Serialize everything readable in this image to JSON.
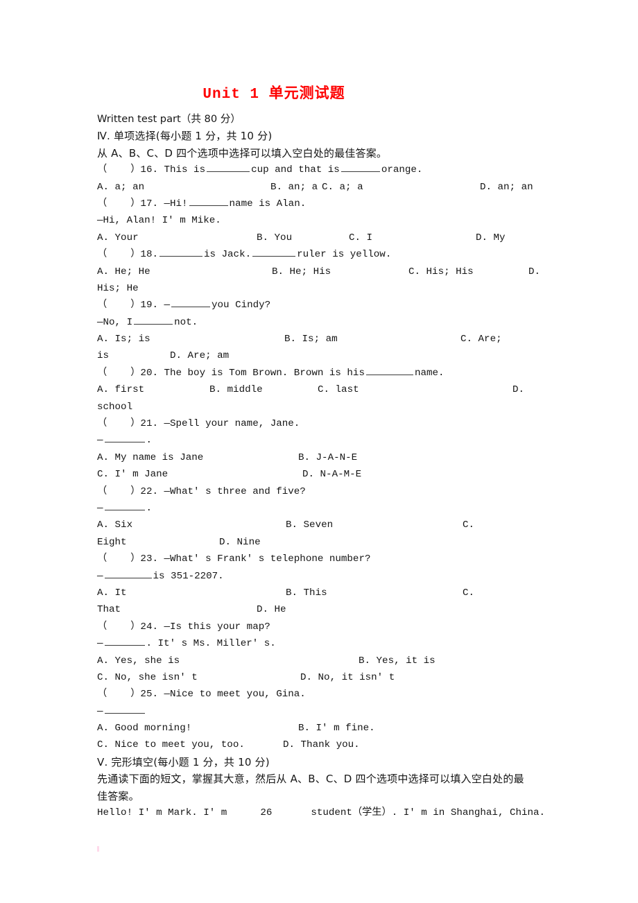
{
  "document": {
    "title": "Unit 1 单元测试题",
    "title_color": "#fe0000",
    "page_background": "#ffffff"
  },
  "intro": {
    "written_test_part": "Written test part（共 80 分）",
    "section_4_heading": "Ⅳ. 单项选择(每小题 1 分，共 10 分)",
    "section_4_instruction": "从 A、B、C、D 四个选项中选择可以填入空白处的最佳答案。"
  },
  "questions": [
    {
      "number": "16",
      "stem_prefix": "（    ）16. This is",
      "stem_middle": "cup and that is",
      "stem_suffix": "orange.",
      "options_line1": [
        "A. a; an",
        "B. an; a",
        "C. a; a",
        "D. an; an"
      ]
    },
    {
      "number": "17",
      "stem_prefix": "（    ）17. —Hi!",
      "stem_suffix": "name is Alan.",
      "stem_line2": "—Hi, Alan! I' m Mike.",
      "options_line1": [
        "A. Your",
        "B. You",
        "C. I",
        "D. My"
      ]
    },
    {
      "number": "18",
      "stem_prefix": "（    ）18.",
      "stem_middle": "is Jack.",
      "stem_suffix": "ruler is yellow.",
      "options_line1": [
        "A. He; He",
        "B. He; His",
        "C. His; His",
        "D."
      ],
      "options_line2": [
        "His; He"
      ]
    },
    {
      "number": "19",
      "stem_prefix": "（    ）19. —",
      "stem_suffix": "you Cindy?",
      "stem_line2_prefix": "—No, I",
      "stem_line2_suffix": "not.",
      "options_line1": [
        "A. Is; is",
        "B. Is; am",
        "C. Are;"
      ],
      "options_line2": [
        "is",
        "D. Are; am"
      ]
    },
    {
      "number": "20",
      "stem_prefix": "（    ）20. The boy is Tom Brown. Brown is his",
      "stem_suffix": "name.",
      "options_line1": [
        "A. first",
        "B. middle",
        "C. last",
        "D."
      ],
      "options_line2": [
        "school"
      ]
    },
    {
      "number": "21",
      "stem_prefix": "（    ）21. —Spell your name, Jane.",
      "stem_line2_prefix": "—",
      "stem_line2_suffix": ".",
      "options_line1": [
        "A. My name is Jane",
        "B. J-A-N-E"
      ],
      "options_line2": [
        "C. I' m Jane",
        "D. N-A-M-E"
      ]
    },
    {
      "number": "22",
      "stem_prefix": "（    ）22. —What' s three and five?",
      "stem_line2_prefix": "—",
      "stem_line2_suffix": ".",
      "options_line1": [
        "A. Six",
        "B. Seven",
        "C."
      ],
      "options_line2": [
        "Eight",
        "D. Nine"
      ]
    },
    {
      "number": "23",
      "stem_prefix": "（    ）23. —What' s Frank' s telephone number?",
      "stem_line2_prefix": "—",
      "stem_line2_suffix": "is 351-2207.",
      "options_line1": [
        "A. It",
        "B. This",
        "C."
      ],
      "options_line2": [
        "That",
        "D. He"
      ]
    },
    {
      "number": "24",
      "stem_prefix": "（    ）24. —Is this your map?",
      "stem_line2_prefix": "—",
      "stem_line2_suffix": ". It' s Ms. Miller' s.",
      "options_line1": [
        "A. Yes, she is",
        "B. Yes, it is"
      ],
      "options_line2": [
        "C. No, she isn' t",
        "D. No, it isn' t"
      ]
    },
    {
      "number": "25",
      "stem_prefix": "（    ）25. —Nice to meet you, Gina.",
      "stem_line2_prefix": "—",
      "stem_line2_suffix": "",
      "options_line1": [
        "A. Good morning!",
        "B. I' m fine."
      ],
      "options_line2": [
        "C. Nice to meet you, too.",
        "D. Thank you."
      ]
    }
  ],
  "section_5": {
    "heading": "Ⅴ. 完形填空(每小题 1 分，共 10 分)",
    "instruction_line1": "先通读下面的短文，掌握其大意，然后从 A、B、C、D 四个选项中选择可以填入空白处的最",
    "instruction_line2": "佳答案。",
    "passage_line1_a": "Hello! I' m Mark. I' m",
    "passage_blank_number": "26",
    "passage_line1_b": "student（学生）. I' m in Shanghai, China."
  }
}
